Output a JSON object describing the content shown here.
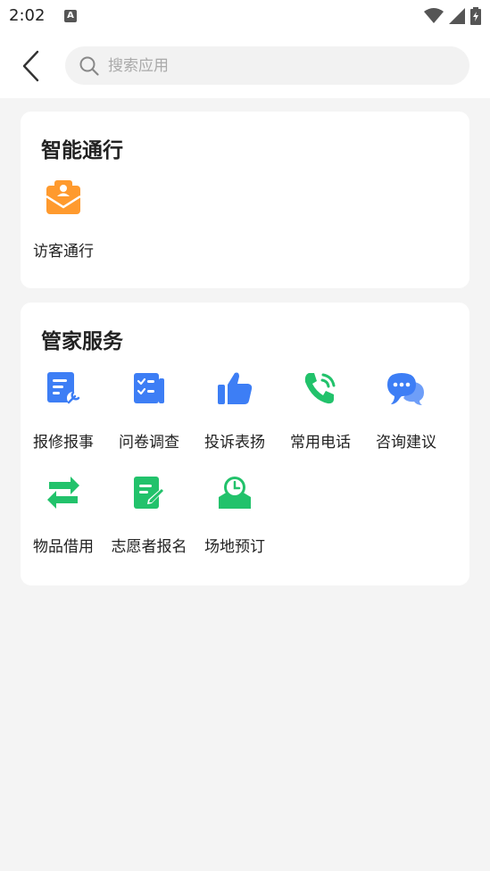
{
  "status": {
    "time": "2:02",
    "notif_letter": "A"
  },
  "header": {
    "search_placeholder": "搜索应用"
  },
  "sections": [
    {
      "title": "智能通行",
      "items": [
        {
          "label": "访客通行",
          "icon": "visitor-pass-icon"
        }
      ]
    },
    {
      "title": "管家服务",
      "items": [
        {
          "label": "报修报事",
          "icon": "repair-icon"
        },
        {
          "label": "问卷调查",
          "icon": "survey-icon"
        },
        {
          "label": "投诉表扬",
          "icon": "thumbs-up-icon"
        },
        {
          "label": "常用电话",
          "icon": "phone-icon"
        },
        {
          "label": "咨询建议",
          "icon": "chat-icon"
        },
        {
          "label": "物品借用",
          "icon": "borrow-icon"
        },
        {
          "label": "志愿者报名",
          "icon": "volunteer-icon"
        },
        {
          "label": "场地预订",
          "icon": "venue-booking-icon"
        }
      ]
    }
  ],
  "colors": {
    "orange": "#ff9a2e",
    "blue": "#3d7ef5",
    "green": "#22c26b"
  }
}
